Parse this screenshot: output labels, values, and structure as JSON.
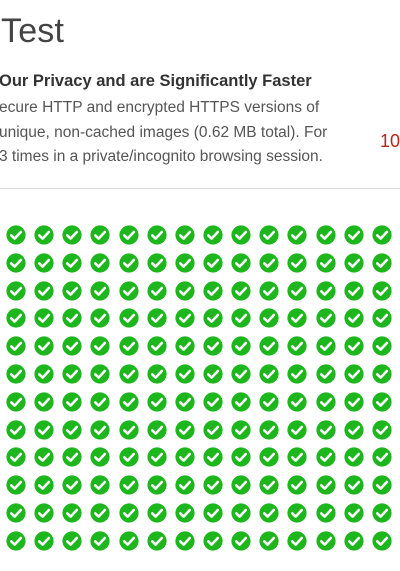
{
  "header": {
    "title": "Test"
  },
  "intro": {
    "heading": "Our Privacy and are Significantly Faster",
    "lines": [
      "ecure HTTP and encrypted HTTPS versions of",
      "unique, non-cached images (0.62 MB total). For",
      "3 times in a private/incognito browsing session."
    ],
    "counter": "10"
  },
  "results": {
    "icon": "check-circle-icon",
    "status": "loaded",
    "color": "#1db71d",
    "rows": 12,
    "columns": 15
  }
}
